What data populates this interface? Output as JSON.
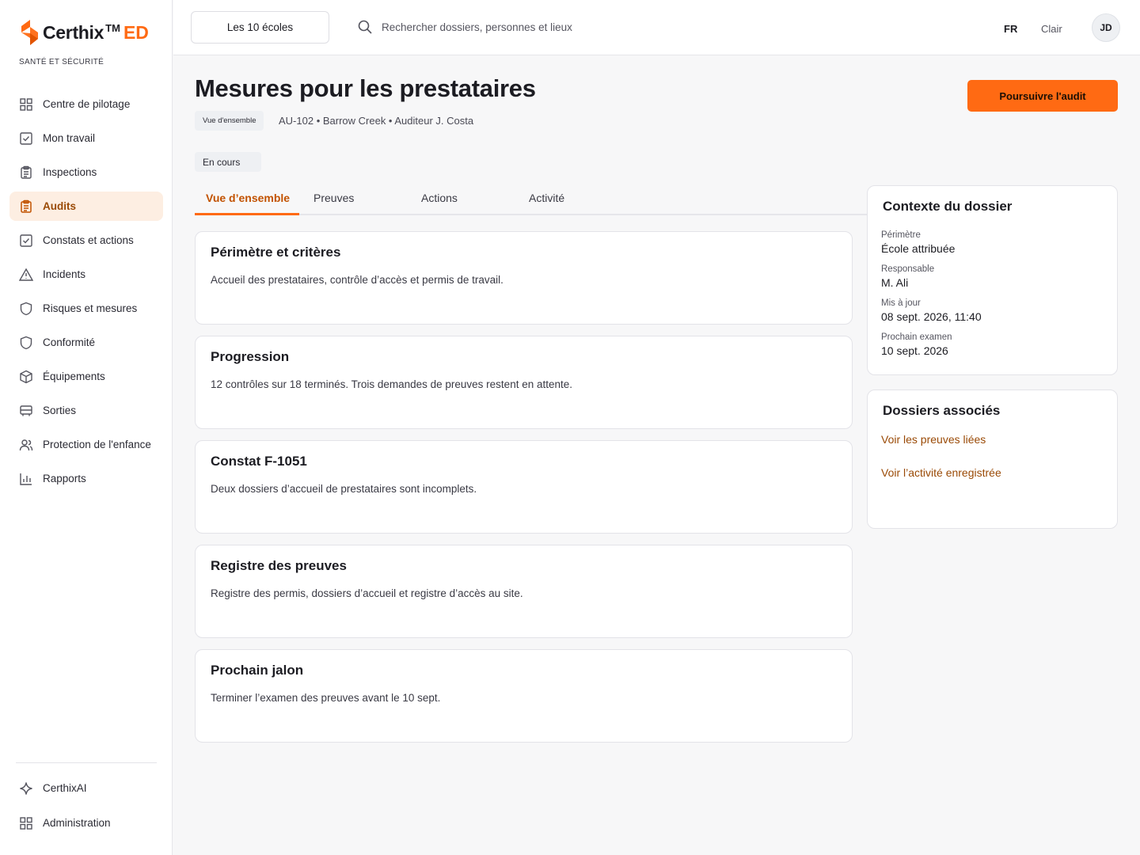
{
  "brand": {
    "name": "Certhix",
    "tm": "TM",
    "suffix": "ED",
    "tagline": "SANTÉ ET SÉCURITÉ",
    "accent": "#ff6a13"
  },
  "sidebar": {
    "items": [
      {
        "label": "Centre de pilotage",
        "icon": "grid-icon"
      },
      {
        "label": "Mon travail",
        "icon": "checkbox-icon"
      },
      {
        "label": "Inspections",
        "icon": "clipboard-icon"
      },
      {
        "label": "Audits",
        "icon": "clipboard-icon",
        "active": true
      },
      {
        "label": "Constats et actions",
        "icon": "checkbox-icon"
      },
      {
        "label": "Incidents",
        "icon": "warning-icon"
      },
      {
        "label": "Risques et mesures",
        "icon": "shield-icon"
      },
      {
        "label": "Conformité",
        "icon": "shield-icon"
      },
      {
        "label": "Équipements",
        "icon": "box-icon"
      },
      {
        "label": "Sorties",
        "icon": "bus-icon"
      },
      {
        "label": "Protection de l'enfance",
        "icon": "people-icon"
      },
      {
        "label": "Rapports",
        "icon": "bar-chart-icon"
      }
    ],
    "bottom": [
      {
        "label": "CerthixAI",
        "icon": "sparkle-icon"
      },
      {
        "label": "Administration",
        "icon": "grid-icon"
      }
    ]
  },
  "topbar": {
    "school_selector": "Les 10 écoles",
    "search_placeholder": "Rechercher dossiers, personnes et lieux",
    "language": "FR",
    "theme": "Clair",
    "avatar_initials": "JD"
  },
  "header": {
    "title": "Mesures pour les prestataires",
    "crumb": "Vue d'ensemble",
    "meta": "AU-102 • Barrow Creek • Auditeur J. Costa",
    "status": "En cours",
    "primary_action": "Poursuivre l'audit"
  },
  "tabs": [
    {
      "label": "Vue d’ensemble",
      "active": true
    },
    {
      "label": "Preuves"
    },
    {
      "label": "Actions"
    },
    {
      "label": "Activité"
    }
  ],
  "cards": [
    {
      "title": "Périmètre et critères",
      "body": "Accueil des prestataires, contrôle d’accès et permis de travail."
    },
    {
      "title": "Progression",
      "body": "12 contrôles sur 18 terminés. Trois demandes de preuves restent en attente."
    },
    {
      "title": "Constat F-1051",
      "body": "Deux dossiers d’accueil de prestataires sont incomplets."
    },
    {
      "title": "Registre des preuves",
      "body": "Registre des permis, dossiers d’accueil et registre d’accès au site."
    },
    {
      "title": "Prochain jalon",
      "body": "Terminer l’examen des preuves avant le 10 sept."
    }
  ],
  "context": {
    "title": "Contexte du dossier",
    "fields": [
      {
        "label": "Périmètre",
        "value": "École attribuée"
      },
      {
        "label": "Responsable",
        "value": "M. Ali"
      },
      {
        "label": "Mis à jour",
        "value": "08 sept. 2026, 11:40"
      },
      {
        "label": "Prochain examen",
        "value": "10 sept. 2026"
      }
    ]
  },
  "related": {
    "title": "Dossiers associés",
    "links": [
      "Voir les preuves liées",
      "Voir l’activité enregistrée"
    ]
  }
}
